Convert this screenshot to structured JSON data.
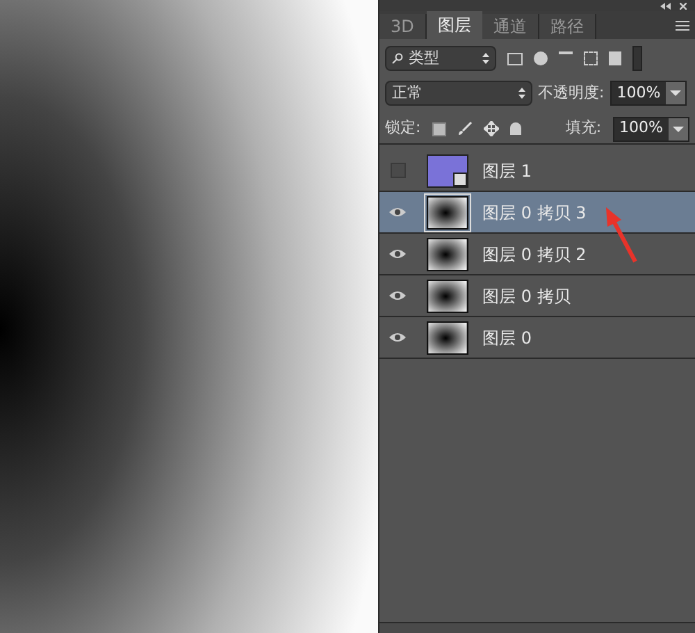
{
  "tabs": [
    {
      "label": "3D",
      "selected": false
    },
    {
      "label": "图层",
      "selected": true
    },
    {
      "label": "通道",
      "selected": false
    },
    {
      "label": "路径",
      "selected": false
    }
  ],
  "filter": {
    "value": "类型"
  },
  "blend_mode": {
    "value": "正常"
  },
  "opacity": {
    "label": "不透明度:",
    "value": "100%"
  },
  "lock": {
    "label": "锁定:"
  },
  "fill": {
    "label": "填充:",
    "value": "100%"
  },
  "layers": [
    {
      "name": "图层 1",
      "visible": false,
      "selected": false,
      "kind": "photo"
    },
    {
      "name": "图层 0 拷贝 3",
      "visible": true,
      "selected": true,
      "kind": "swirl"
    },
    {
      "name": "图层 0 拷贝 2",
      "visible": true,
      "selected": false,
      "kind": "swirl"
    },
    {
      "name": "图层 0 拷贝",
      "visible": true,
      "selected": false,
      "kind": "swirl"
    },
    {
      "name": "图层 0",
      "visible": true,
      "selected": false,
      "kind": "swirl"
    }
  ]
}
